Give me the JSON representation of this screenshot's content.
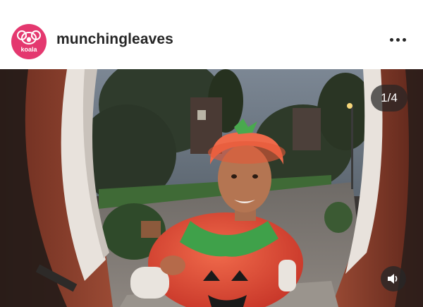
{
  "post": {
    "username": "munchingleaves",
    "avatar_text": "koala",
    "more_icon": "more-horizontal-icon"
  },
  "media": {
    "counter": "1/4",
    "sound_icon": "speaker-icon"
  },
  "colors": {
    "avatar_bg": "#e4386f",
    "text": "#262626",
    "overlay": "#262626"
  }
}
